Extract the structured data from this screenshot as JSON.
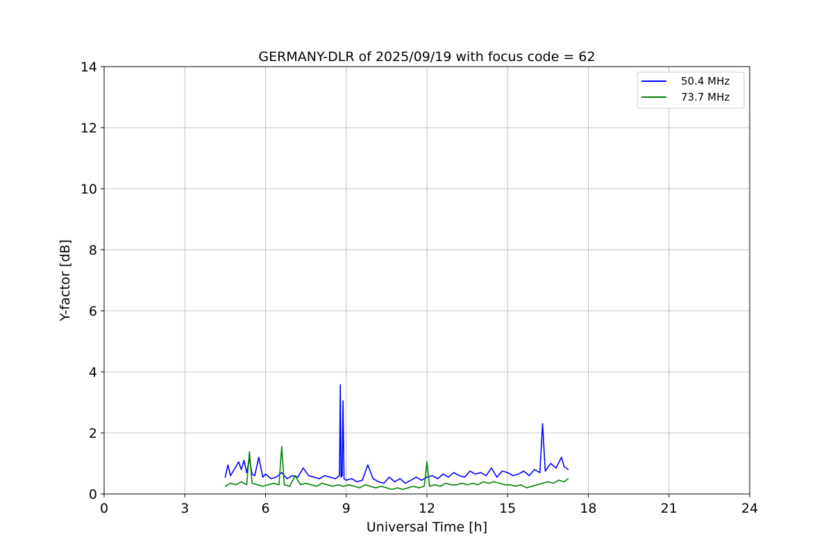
{
  "chart_data": {
    "type": "line",
    "title": "GERMANY-DLR of 2025/09/19 with focus code = 62",
    "xlabel": "Universal Time [h]",
    "ylabel": "Y-factor [dB]",
    "xlim": [
      0,
      24
    ],
    "ylim": [
      0,
      14
    ],
    "xticks": [
      "0",
      "3",
      "6",
      "9",
      "12",
      "15",
      "18",
      "21",
      "24"
    ],
    "yticks": [
      "0",
      "2",
      "4",
      "6",
      "8",
      "10",
      "12",
      "14"
    ],
    "grid": true,
    "legend_position": "top-right",
    "series": [
      {
        "name": "50.4 MHz",
        "color": "#0000ff",
        "x": [
          4.5,
          4.6,
          4.7,
          4.8,
          4.9,
          5.0,
          5.1,
          5.2,
          5.3,
          5.4,
          5.5,
          5.6,
          5.75,
          5.9,
          6.0,
          6.2,
          6.4,
          6.6,
          6.8,
          7.0,
          7.2,
          7.4,
          7.6,
          7.8,
          8.0,
          8.2,
          8.4,
          8.6,
          8.75,
          8.78,
          8.81,
          8.85,
          8.88,
          8.92,
          9.0,
          9.2,
          9.4,
          9.6,
          9.8,
          10.0,
          10.2,
          10.4,
          10.6,
          10.8,
          11.0,
          11.2,
          11.4,
          11.6,
          11.8,
          12.0,
          12.2,
          12.4,
          12.6,
          12.8,
          13.0,
          13.2,
          13.4,
          13.6,
          13.8,
          14.0,
          14.2,
          14.4,
          14.6,
          14.8,
          15.0,
          15.2,
          15.4,
          15.6,
          15.8,
          16.0,
          16.2,
          16.3,
          16.4,
          16.6,
          16.8,
          17.0,
          17.1,
          17.25
        ],
        "values": [
          0.55,
          0.95,
          0.6,
          0.75,
          0.9,
          1.05,
          0.8,
          1.1,
          0.7,
          1.15,
          0.65,
          0.6,
          1.2,
          0.55,
          0.65,
          0.5,
          0.55,
          0.7,
          0.5,
          0.6,
          0.55,
          0.85,
          0.6,
          0.55,
          0.5,
          0.6,
          0.55,
          0.5,
          0.6,
          3.58,
          0.55,
          0.6,
          3.05,
          0.5,
          0.45,
          0.5,
          0.4,
          0.45,
          0.95,
          0.5,
          0.4,
          0.35,
          0.55,
          0.4,
          0.5,
          0.35,
          0.45,
          0.55,
          0.45,
          0.55,
          0.6,
          0.5,
          0.65,
          0.55,
          0.7,
          0.6,
          0.55,
          0.75,
          0.65,
          0.7,
          0.6,
          0.85,
          0.55,
          0.75,
          0.7,
          0.6,
          0.65,
          0.75,
          0.6,
          0.8,
          0.7,
          2.3,
          0.75,
          1.0,
          0.85,
          1.2,
          0.9,
          0.8
        ]
      },
      {
        "name": "73.7 MHz",
        "color": "#008000",
        "x": [
          4.5,
          4.7,
          4.9,
          5.1,
          5.3,
          5.4,
          5.5,
          5.7,
          5.9,
          6.1,
          6.3,
          6.5,
          6.6,
          6.7,
          6.9,
          7.1,
          7.3,
          7.5,
          7.7,
          7.9,
          8.1,
          8.3,
          8.5,
          8.7,
          8.9,
          9.1,
          9.3,
          9.5,
          9.7,
          9.9,
          10.1,
          10.3,
          10.5,
          10.7,
          10.9,
          11.1,
          11.3,
          11.5,
          11.7,
          11.9,
          12.0,
          12.1,
          12.3,
          12.5,
          12.7,
          12.9,
          13.1,
          13.3,
          13.5,
          13.7,
          13.9,
          14.1,
          14.3,
          14.5,
          14.7,
          14.9,
          15.1,
          15.3,
          15.5,
          15.7,
          15.9,
          16.1,
          16.3,
          16.5,
          16.7,
          16.9,
          17.1,
          17.25
        ],
        "values": [
          0.25,
          0.35,
          0.3,
          0.4,
          0.3,
          1.38,
          0.35,
          0.3,
          0.25,
          0.3,
          0.35,
          0.3,
          1.55,
          0.3,
          0.25,
          0.6,
          0.3,
          0.35,
          0.3,
          0.25,
          0.35,
          0.3,
          0.25,
          0.3,
          0.25,
          0.3,
          0.25,
          0.2,
          0.3,
          0.25,
          0.2,
          0.25,
          0.2,
          0.15,
          0.2,
          0.15,
          0.2,
          0.25,
          0.2,
          0.25,
          1.05,
          0.25,
          0.3,
          0.25,
          0.35,
          0.3,
          0.3,
          0.35,
          0.3,
          0.35,
          0.3,
          0.4,
          0.35,
          0.4,
          0.35,
          0.3,
          0.3,
          0.25,
          0.3,
          0.2,
          0.25,
          0.3,
          0.35,
          0.4,
          0.35,
          0.45,
          0.4,
          0.5
        ]
      }
    ]
  }
}
